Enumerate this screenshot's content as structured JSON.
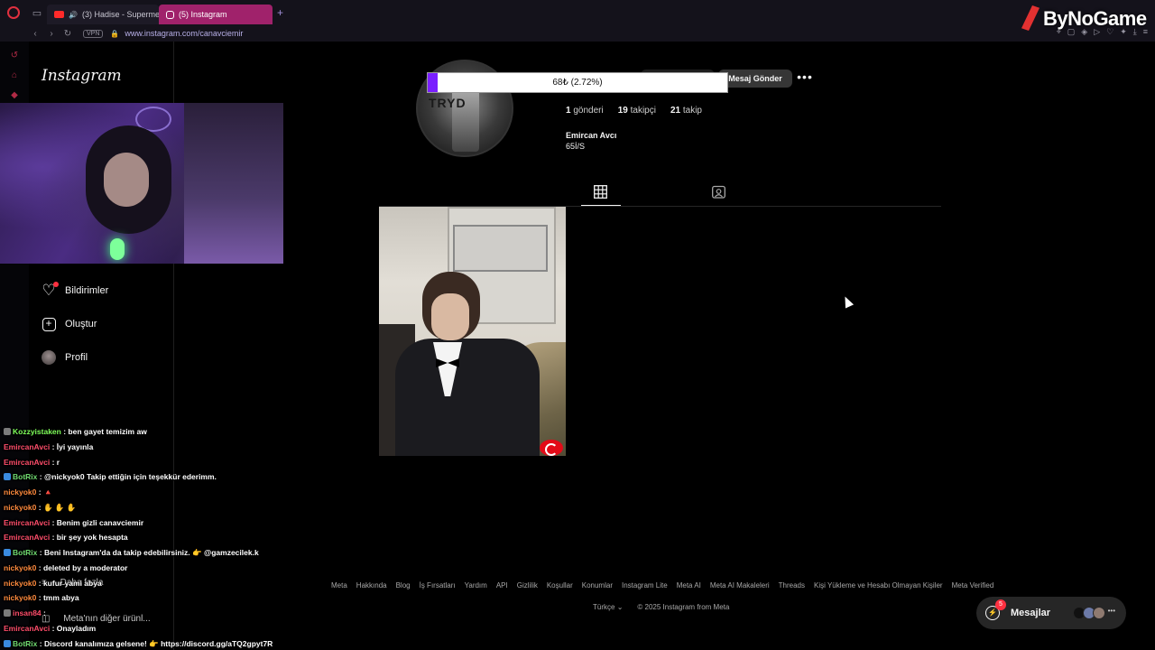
{
  "browser": {
    "tabs": [
      {
        "label": "(3) Hadise - Superme"
      },
      {
        "label": "(5) Instagram"
      }
    ],
    "new_tab": "+",
    "vpn": "VPN",
    "url": "www.instagram.com/canavciemir"
  },
  "brand": {
    "name": "ByNoGame"
  },
  "instagram": {
    "logo": "Instagram",
    "nav": [
      {
        "label": "Bildirimler",
        "icon": "heart-icon"
      },
      {
        "label": "Oluştur",
        "icon": "plus-icon"
      },
      {
        "label": "Profil",
        "icon": "avatar"
      }
    ],
    "more": "Daha fazla",
    "meta_menu": "Meta'nın diğer ürünl..."
  },
  "profile": {
    "progress_text": "68₺ (2.72%)",
    "progress_fraction": 0.0272,
    "profile_pic_text": "TRYD",
    "message_button": "Mesaj Gönder",
    "more_button": "•••",
    "stats": {
      "posts_count": "1",
      "posts_label": "gönderi",
      "followers_count": "19",
      "followers_label": "takipçi",
      "following_count": "21",
      "following_label": "takip"
    },
    "full_name": "Emircan Avcı",
    "bio": "65İ/S"
  },
  "footer": {
    "links": [
      "Meta",
      "Hakkında",
      "Blog",
      "İş Fırsatları",
      "Yardım",
      "API",
      "Gizlilik",
      "Koşullar",
      "Konumlar",
      "Instagram Lite",
      "Meta AI",
      "Meta AI Makaleleri",
      "Threads",
      "Kişi Yükleme ve Hesabı Olmayan Kişiler",
      "Meta Verified"
    ],
    "language": "Türkçe",
    "copyright": "© 2025 Instagram from Meta"
  },
  "messages": {
    "label": "Mesajlar",
    "badge": "5"
  },
  "chat": [
    {
      "user": "Kozzyistaken",
      "text": ": ben gayet temizim aw",
      "color": "#7fff5a",
      "badge": "#7b7b7b"
    },
    {
      "user": "EmircanAvci",
      "text": ": İyi yayınla",
      "color": "#ff4d6a",
      "badge": ""
    },
    {
      "user": "EmircanAvci",
      "text": ": r",
      "color": "#ff4d6a",
      "badge": ""
    },
    {
      "user": "BotRix",
      "text": ": @nickyok0 Takip ettiğin için teşekkür ederimm.",
      "color": "#6fd96f",
      "badge": "#3a8be0"
    },
    {
      "user": "nickyok0",
      "text": ": 🔺",
      "color": "#ff8a3d",
      "badge": ""
    },
    {
      "user": "nickyok0",
      "text": ": ✋ ✋ ✋",
      "color": "#ff8a3d",
      "badge": ""
    },
    {
      "user": "EmircanAvci",
      "text": ": Benim gizli canavciemir",
      "color": "#ff4d6a",
      "badge": ""
    },
    {
      "user": "EmircanAvci",
      "text": ": bir şey yok hesapta",
      "color": "#ff4d6a",
      "badge": ""
    },
    {
      "user": "BotRix",
      "text": ": Beni Instagram'da da takip edebilirsiniz. 👉 @gamzecilek.k",
      "color": "#6fd96f",
      "badge": "#3a8be0"
    },
    {
      "user": "nickyok0",
      "text": ": deleted by a moderator",
      "color": "#ff8a3d",
      "badge": ""
    },
    {
      "user": "nickyok0",
      "text": ": kufur yami abya",
      "color": "#ff8a3d",
      "badge": ""
    },
    {
      "user": "nickyok0",
      "text": ": tmm abya",
      "color": "#ff8a3d",
      "badge": ""
    },
    {
      "user": "insan84",
      "text": ":",
      "color": "#ff4d6a",
      "badge": "#7b7b7b"
    },
    {
      "user": "EmircanAvci",
      "text": ": Onayladım",
      "color": "#ff4d6a",
      "badge": ""
    },
    {
      "user": "BotRix",
      "text": ": Discord kanalımıza gelsene! 👉 https://discord.gg/aTQ2gpyt7R",
      "color": "#6fd96f",
      "badge": "#3a8be0"
    }
  ]
}
